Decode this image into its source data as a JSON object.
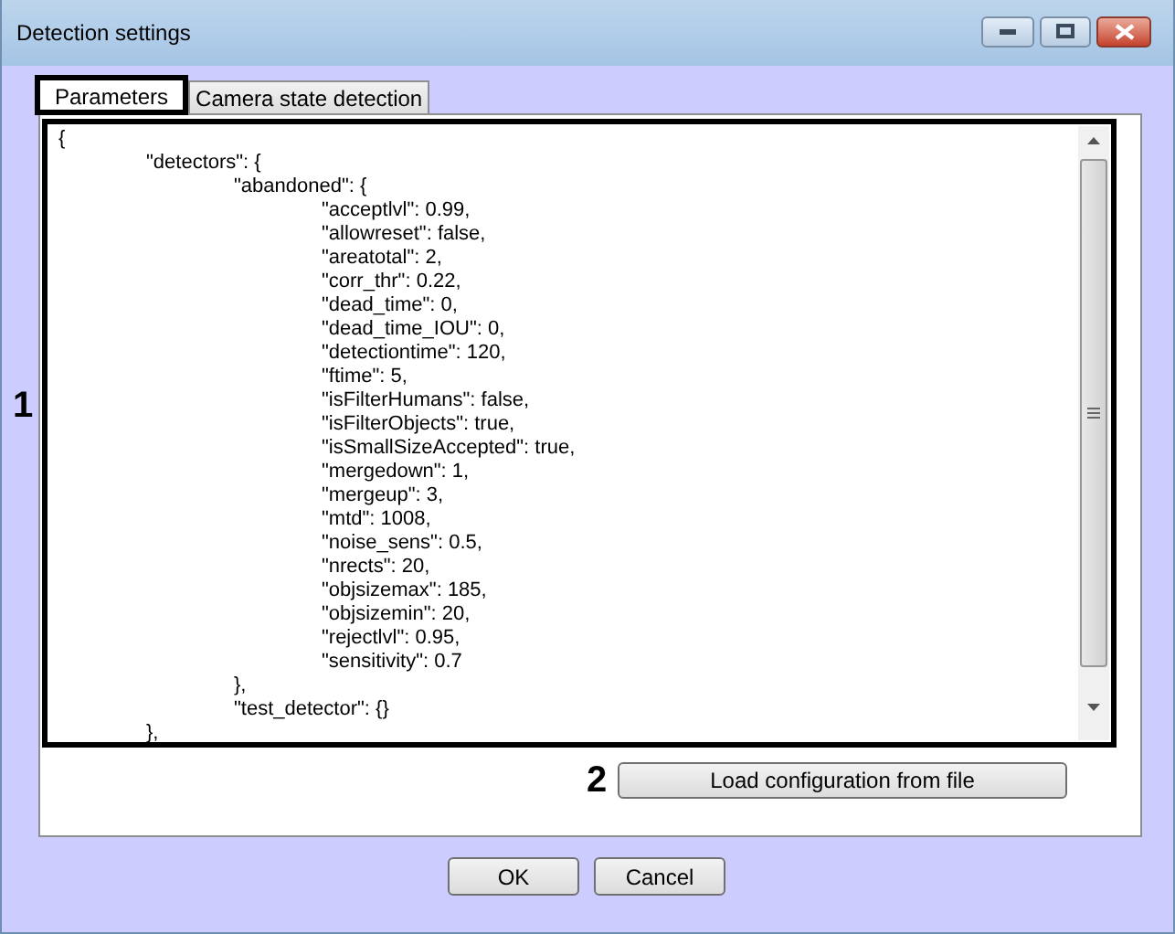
{
  "window": {
    "title": "Detection settings"
  },
  "tabs": [
    {
      "label": "Parameters",
      "selected": true
    },
    {
      "label": "Camera state detection",
      "selected": false
    }
  ],
  "editor": {
    "lines": [
      {
        "text": "{",
        "children": [
          {
            "text": "\"detectors\": {",
            "children": [
              {
                "text": "\"abandoned\": {",
                "children": [
                  {
                    "text": "\"acceptlvl\": 0.99,"
                  },
                  {
                    "text": "\"allowreset\": false,"
                  },
                  {
                    "text": "\"areatotal\": 2,"
                  },
                  {
                    "text": "\"corr_thr\": 0.22,"
                  },
                  {
                    "text": "\"dead_time\": 0,"
                  },
                  {
                    "text": "\"dead_time_IOU\": 0,"
                  },
                  {
                    "text": "\"detectiontime\": 120,"
                  },
                  {
                    "text": "\"ftime\": 5,"
                  },
                  {
                    "text": "\"isFilterHumans\": false,"
                  },
                  {
                    "text": "\"isFilterObjects\": true,"
                  },
                  {
                    "text": "\"isSmallSizeAccepted\": true,"
                  },
                  {
                    "text": "\"mergedown\": 1,"
                  },
                  {
                    "text": "\"mergeup\": 3,"
                  },
                  {
                    "text": "\"mtd\": 1008,"
                  },
                  {
                    "text": "\"noise_sens\": 0.5,"
                  },
                  {
                    "text": "\"nrects\": 20,"
                  },
                  {
                    "text": "\"objsizemax\": 185,"
                  },
                  {
                    "text": "\"objsizemin\": 20,"
                  },
                  {
                    "text": "\"rejectlvl\": 0.95,"
                  },
                  {
                    "text": "\"sensitivity\": 0.7"
                  }
                ]
              },
              {
                "text": "},"
              },
              {
                "text": "\"test_detector\": {}"
              }
            ]
          },
          {
            "text": "},"
          }
        ]
      }
    ]
  },
  "load_button": {
    "label": "Load configuration from file"
  },
  "annotations": [
    {
      "label": "1"
    },
    {
      "label": "2"
    }
  ],
  "buttons": [
    {
      "label": "OK"
    },
    {
      "label": "Cancel"
    }
  ]
}
